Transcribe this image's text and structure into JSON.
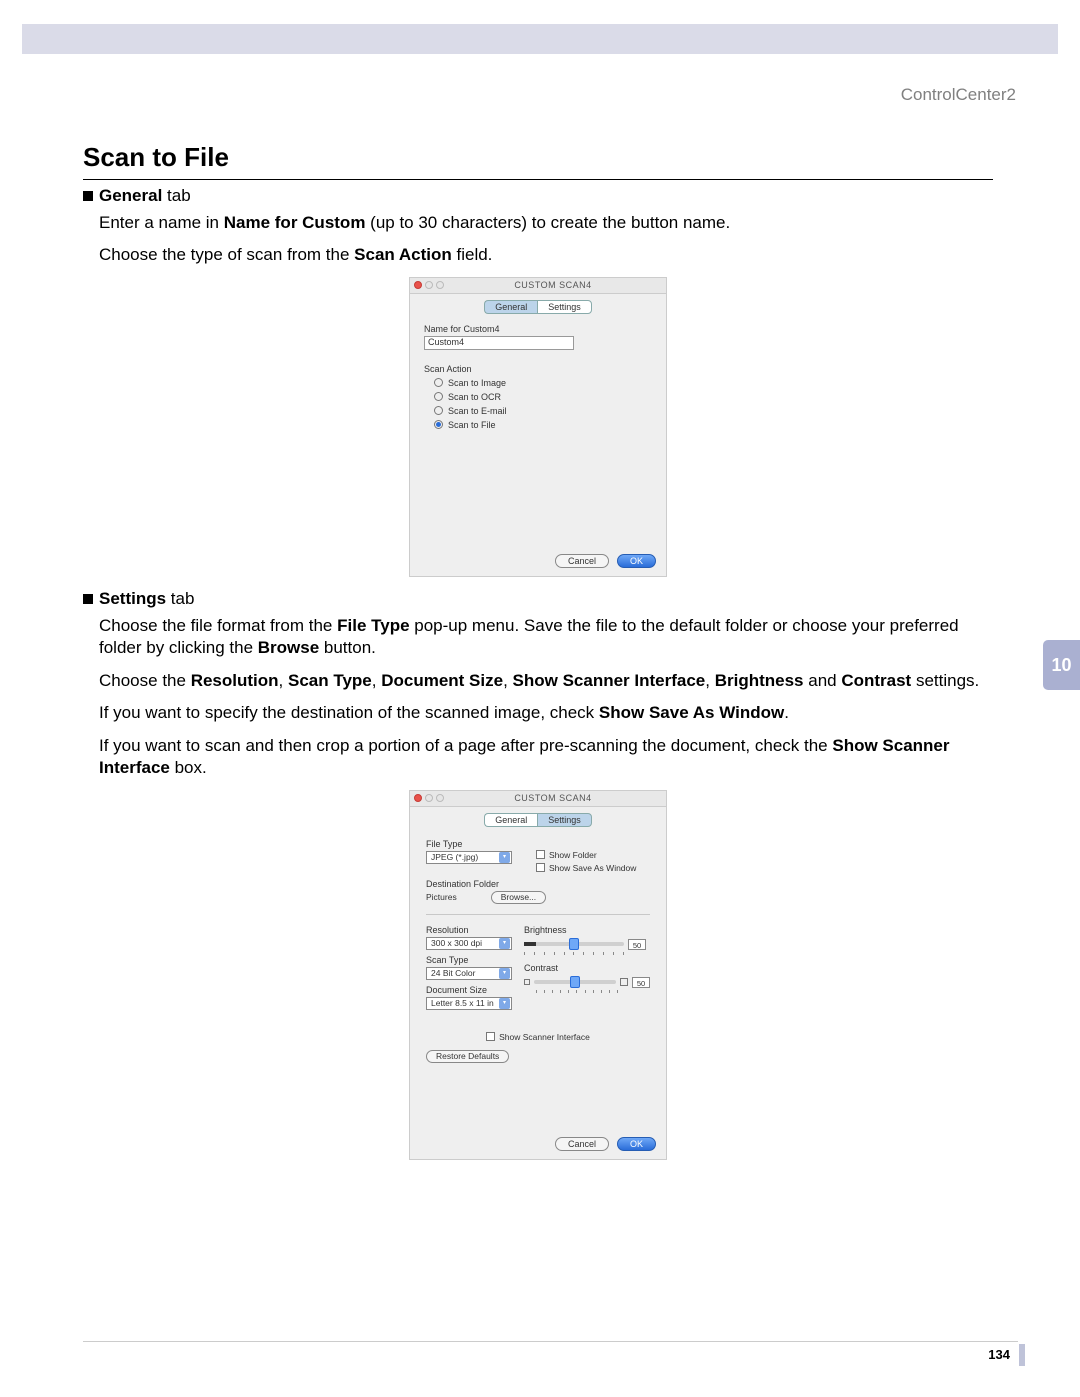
{
  "header_right": "ControlCenter2",
  "page_title": "Scan to File",
  "side_tab": "10",
  "page_number": "134",
  "general": {
    "bullet_label_bold": "General",
    "bullet_label_rest": " tab",
    "para1_pre": "Enter a name in ",
    "para1_bold": "Name for Custom",
    "para1_post": " (up to 30 characters) to create the button name.",
    "para2_pre": "Choose the type of scan from the ",
    "para2_bold": "Scan Action",
    "para2_post": " field."
  },
  "settings": {
    "bullet_label_bold": "Settings",
    "bullet_label_rest": " tab",
    "p1_a": "Choose the file format from the ",
    "p1_b": "File Type",
    "p1_c": " pop-up menu. Save the file to the default folder or choose your preferred folder by clicking the ",
    "p1_d": "Browse",
    "p1_e": " button.",
    "p2_a": "Choose the ",
    "p2_b1": "Resolution",
    "p2_s1": ", ",
    "p2_b2": "Scan Type",
    "p2_s2": ", ",
    "p2_b3": "Document Size",
    "p2_s3": ", ",
    "p2_b4": "Show Scanner Interface",
    "p2_s4": ", ",
    "p2_b5": "Brightness",
    "p2_s5": " and ",
    "p2_b6": "Contrast",
    "p2_e": " settings.",
    "p3_a": "If you want to specify the destination of the scanned image, check ",
    "p3_b": "Show Save As Window",
    "p3_c": ".",
    "p4_a": "If you want to scan and then crop a portion of a page after pre-scanning the document, check the ",
    "p4_b": "Show Scanner Interface",
    "p4_c": " box."
  },
  "dialog_general": {
    "title": "CUSTOM SCAN4",
    "tab_general": "General",
    "tab_settings": "Settings",
    "label_name": "Name for Custom4",
    "input_value": "Custom4",
    "label_action": "Scan Action",
    "radio_image": "Scan to Image",
    "radio_ocr": "Scan to OCR",
    "radio_email": "Scan to E-mail",
    "radio_file": "Scan to File",
    "btn_cancel": "Cancel",
    "btn_ok": "OK"
  },
  "dialog_settings": {
    "title": "CUSTOM SCAN4",
    "tab_general": "General",
    "tab_settings": "Settings",
    "label_filetype": "File Type",
    "filetype_value": "JPEG (*.jpg)",
    "chk_show_folder": "Show Folder",
    "chk_show_saveas": "Show Save As Window",
    "label_destfolder": "Destination Folder",
    "destfolder_value": "Pictures",
    "btn_browse": "Browse...",
    "label_resolution": "Resolution",
    "resolution_value": "300 x 300 dpi",
    "label_scantype": "Scan Type",
    "scantype_value": "24 Bit Color",
    "label_docsize": "Document Size",
    "docsize_value": "Letter  8.5 x 11 in",
    "label_brightness": "Brightness",
    "brightness_value": "50",
    "label_contrast": "Contrast",
    "contrast_value": "50",
    "chk_show_scanner_iface": "Show Scanner Interface",
    "btn_restore": "Restore Defaults",
    "btn_cancel": "Cancel",
    "btn_ok": "OK"
  }
}
